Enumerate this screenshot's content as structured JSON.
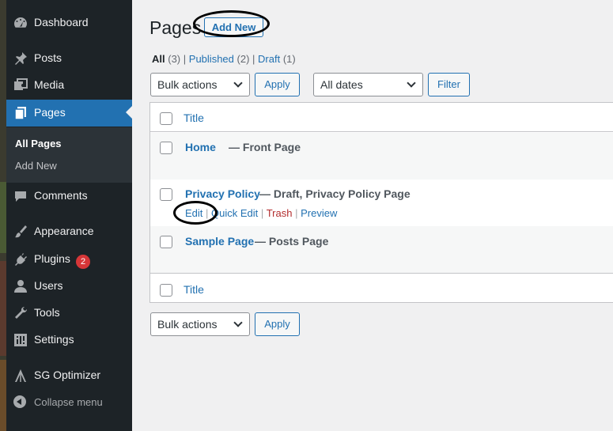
{
  "sidebar": {
    "items": [
      {
        "label": "Dashboard",
        "icon": "dashboard-icon"
      },
      {
        "label": "Posts",
        "icon": "pin-icon"
      },
      {
        "label": "Media",
        "icon": "media-icon"
      },
      {
        "label": "Pages",
        "icon": "pages-icon"
      },
      {
        "label": "Comments",
        "icon": "comment-icon"
      },
      {
        "label": "Appearance",
        "icon": "brush-icon"
      },
      {
        "label": "Plugins",
        "icon": "plug-icon"
      },
      {
        "label": "Users",
        "icon": "user-icon"
      },
      {
        "label": "Tools",
        "icon": "wrench-icon"
      },
      {
        "label": "Settings",
        "icon": "settings-icon"
      },
      {
        "label": "SG Optimizer",
        "icon": "sg-optimizer-icon"
      }
    ],
    "submenu": [
      "All Pages",
      "Add New"
    ],
    "plugins_badge": "2",
    "collapse_label": "Collapse menu"
  },
  "header": {
    "title": "Pages",
    "add_new": "Add New"
  },
  "filters": {
    "all_label": "All",
    "all_count": "(3)",
    "published_label": "Published",
    "published_count": "(2)",
    "draft_label": "Draft",
    "draft_count": "(1)",
    "separator": "|"
  },
  "toolbar": {
    "bulk_actions": "Bulk actions",
    "apply": "Apply",
    "all_dates": "All dates",
    "filter": "Filter"
  },
  "table": {
    "column_title": "Title",
    "rows": [
      {
        "title": "Home",
        "state": "— Front Page"
      },
      {
        "title": "Privacy Policy",
        "state": "— Draft, Privacy Policy Page"
      },
      {
        "title": "Sample Page",
        "state": "— Posts Page"
      }
    ],
    "row_actions": [
      "Edit",
      "Quick Edit",
      "Trash",
      "Preview"
    ],
    "action_separator": "|"
  },
  "colors": {
    "sidebar_bg": "#1d2327",
    "accent": "#2271b1",
    "badge": "#d63638",
    "trash": "#b32d2e"
  }
}
